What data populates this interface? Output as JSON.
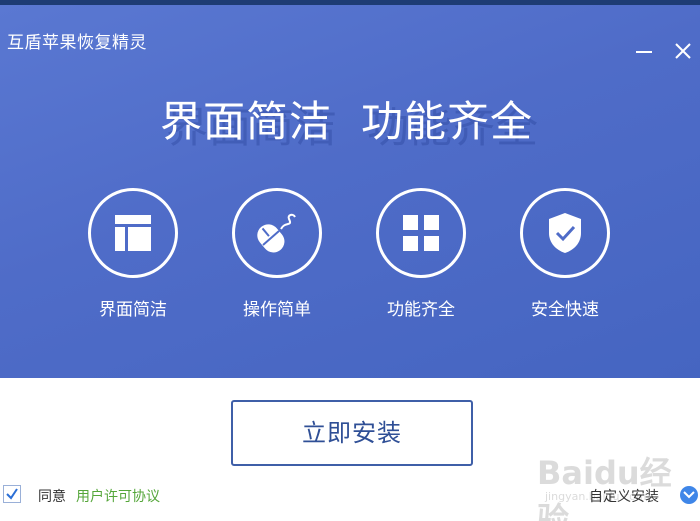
{
  "app": {
    "title": "互盾苹果恢复精灵"
  },
  "window_controls": {
    "minimize_icon": "minimize-icon",
    "close_icon": "close-icon"
  },
  "headline": {
    "part1": "界面简洁",
    "part2": "功能齐全"
  },
  "features": [
    {
      "label": "界面简洁",
      "icon": "layout-icon"
    },
    {
      "label": "操作简单",
      "icon": "mouse-icon"
    },
    {
      "label": "功能齐全",
      "icon": "grid-icon"
    },
    {
      "label": "安全快速",
      "icon": "shield-check-icon"
    }
  ],
  "install": {
    "button_label": "立即安装"
  },
  "agreement": {
    "checked": true,
    "agree_label": "同意",
    "license_link": "用户许可协议"
  },
  "custom_install": {
    "label": "自定义安装"
  },
  "watermark": {
    "text": "Baidu经验",
    "sub": "jingyan.baidu.com"
  },
  "colors": {
    "hero_background": "#4f6cc8",
    "title_bar_line": "#1e3c74",
    "install_border": "#3f5fa8",
    "install_text": "#2f4f96",
    "link_green": "#55a63a",
    "chevron_blue": "#3f86e8"
  }
}
